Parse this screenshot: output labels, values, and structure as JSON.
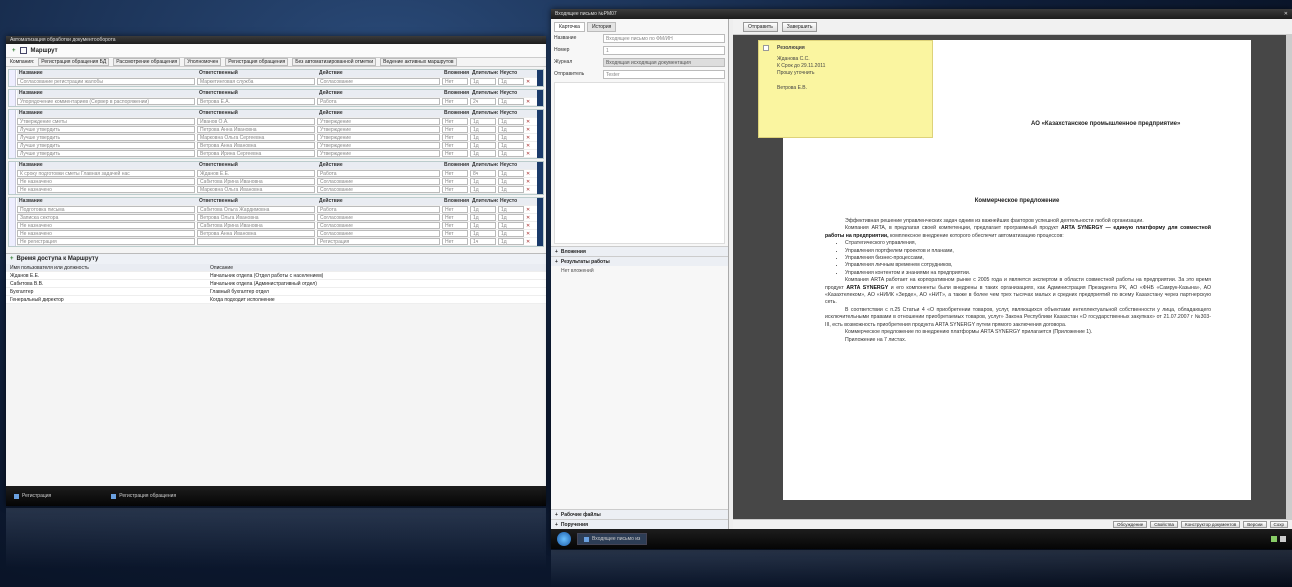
{
  "left_window": {
    "title": "Автоматизация обработки документооборота",
    "toolbar_title": "Маршрут",
    "filters": [
      "Компания:",
      "Регистрация обращения БД",
      "Рассмотрение обращения",
      "Уполномочен",
      "Регистрация обращения",
      "Без автоматизированной отметки",
      "Ведение активных маршрутов"
    ],
    "col_headers": [
      "Название",
      "Ответственный",
      "Действие",
      "Вложения",
      "Длительность",
      "Неусто"
    ],
    "blocks": [
      {
        "rows": [
          [
            "Согласование регистрации жалобы",
            "Маркетинговая служба",
            "Согласование",
            "Нет",
            "1д",
            "1д"
          ]
        ]
      },
      {
        "rows": [
          [
            "Упорядочение комментариев (Сервер в распоряжении)",
            "Ветрова Е.А.",
            "Работа",
            "Нет",
            "2ч",
            "1д"
          ]
        ]
      },
      {
        "rows": [
          [
            "Утверждение сметы",
            "Иванов О.А.",
            "Утверждение",
            "Нет",
            "1д",
            "1д"
          ],
          [
            "Лучше утвердить",
            "Петрова Анна Ивановна",
            "Утверждение",
            "Нет",
            "1д",
            "1д"
          ],
          [
            "Лучше утвердить",
            "Марковна Ольга Сергеевна",
            "Утверждение",
            "Нет",
            "1д",
            "1д"
          ],
          [
            "Лучше утвердить",
            "Ветрова Анна Ивановна",
            "Утверждение",
            "Нет",
            "1д",
            "1д"
          ],
          [
            "Лучше утвердить",
            "Ветрова Ирина Сергеевна",
            "Утверждение",
            "Нет",
            "1д",
            "1д"
          ]
        ]
      },
      {
        "rows": [
          [
            "К сроку подготовки сметы Главная задачей нас",
            "Жданов Е.Е.",
            "Работа",
            "Нет",
            "8ч",
            "1д"
          ],
          [
            "Не назначено",
            "Сабитова Ирина Ивановна",
            "Согласование",
            "Нет",
            "1д",
            "1д"
          ],
          [
            "Не назначено",
            "Марковна Ольга Ивановна",
            "Согласование",
            "Нет",
            "1д",
            "1д"
          ]
        ]
      },
      {
        "rows": [
          [
            "Подготовка письма",
            "Сабитова Ольга Жардимовна",
            "Работа",
            "Нет",
            "1д",
            "1д"
          ],
          [
            "Записка сектора",
            "Ветрова Ольга Ивановна",
            "Согласование",
            "Нет",
            "1д",
            "1д"
          ],
          [
            "Не назначено",
            "Сабитова Ирина Ивановна",
            "Согласование",
            "Нет",
            "1д",
            "1д"
          ],
          [
            "Не назначено",
            "Ветрова Анна Ивановна",
            "Согласование",
            "Нет",
            "1д",
            "1д"
          ],
          [
            "Не регистрация",
            "",
            "Регистрация",
            "Нет",
            "1ч",
            "1д"
          ]
        ]
      }
    ],
    "bottom_section": {
      "title": "Время доступа к Маршруту",
      "col_headers": [
        "Имя пользователя или должность",
        "Описание"
      ],
      "rows": [
        [
          "Жданов Е.Е.",
          "Начальник отдела (Отдел работы с населением)"
        ],
        [
          "Сабитова В.В.",
          "Начальник отдела (Административный отдел)"
        ],
        [
          "Бухгалтер",
          "Главный бухгалтер отдел"
        ],
        [
          "Генеральный директор",
          "Когда подходит исполнение"
        ]
      ]
    },
    "taskbar": [
      "Регистрация",
      "Регистрация обращения"
    ]
  },
  "right_window": {
    "title": "Входящее письмо №PM07",
    "tabs": [
      "Карточка",
      "История"
    ],
    "fields": [
      {
        "label": "Название",
        "value": "Входящее письмо по ФМ/ИН"
      },
      {
        "label": "Номер",
        "value": "1"
      },
      {
        "label": "Журнал",
        "value": "Входящая исходящая документация"
      },
      {
        "label": "Отправитель",
        "value": "Tester"
      }
    ],
    "sections": [
      "Вложения",
      "Результаты работы"
    ],
    "subsection": "Нет вложений",
    "bottom_sections": [
      "Рабочие файлы",
      "Поручения"
    ],
    "toolbar": [
      "Отправить",
      "Завершить"
    ],
    "sticky": {
      "title": "Резолюция",
      "lines": [
        "Жданова С.С.",
        "К Срок до 29.11.2011",
        "Прошу уточнить",
        "",
        "Ветрова Е.В."
      ]
    },
    "doc": {
      "org": "АО «Казахстанское промышленное предприятие»",
      "title": "Коммерческое предложение",
      "p1": "Эффективная решение управленческих задач одним из важнейших факторов успешной деятельности любой организации.",
      "p2a": "Компания ARTA, в предлагая своей компетенции, предлагает программный продукт",
      "p2b": "ARTA SYNERGY — единую платформу для совместной работы на предприятии,",
      "p2c": "комплексное внедрение которого обеспечит автоматизацию процессов:",
      "list": [
        "Стратегического управления,",
        "Управления портфелем проектов и планами,",
        "Управления бизнес-процессами,",
        "Управления личным временем сотрудников,",
        "Управления контентом и знаниями на предприятии."
      ],
      "p3a": "Компания ARTA работает на корпоративном рынке с 2005 года и является экспертом в области совместной работы на предприятии. За это время продукт",
      "p3b": "ARTA SYNERGY",
      "p3c": "и его компоненты были внедрены в таких организациях, как Администрация Президента РК, АО «ФНБ «Самрук-Казына», АО «Казахтелеком», АО «НИИК «Зердe», АО «НИТ», а также в более чем трех тысячах малых и средних предприятий по всему Казахстану через партнерскую сеть.",
      "p4": "В соответствии с п.25 Статьи 4 «О приобретении товаров, услуг, являющихся объектами интеллектуальной собственности у лица, обладающего исключительными правами в отношении приобретаемых товаров, услуг» Закона Республики Казахстан «О государственных закупках» от 21.07.2007 г №303-III, есть возможность приобретения продукта ARTA SYNERGY путем прямого заключения договора.",
      "p5": "Коммерческое предложение по внедрению платформы ARTA SYNERGY прилагается (Приложение 1).",
      "p6": "Приложение на 7 листах."
    },
    "statusbar": [
      "Обсуждение",
      "Свойства",
      "Конструктор документов",
      "Версии",
      "Сохр"
    ],
    "taskbar_task": "Входящее письмо из"
  }
}
